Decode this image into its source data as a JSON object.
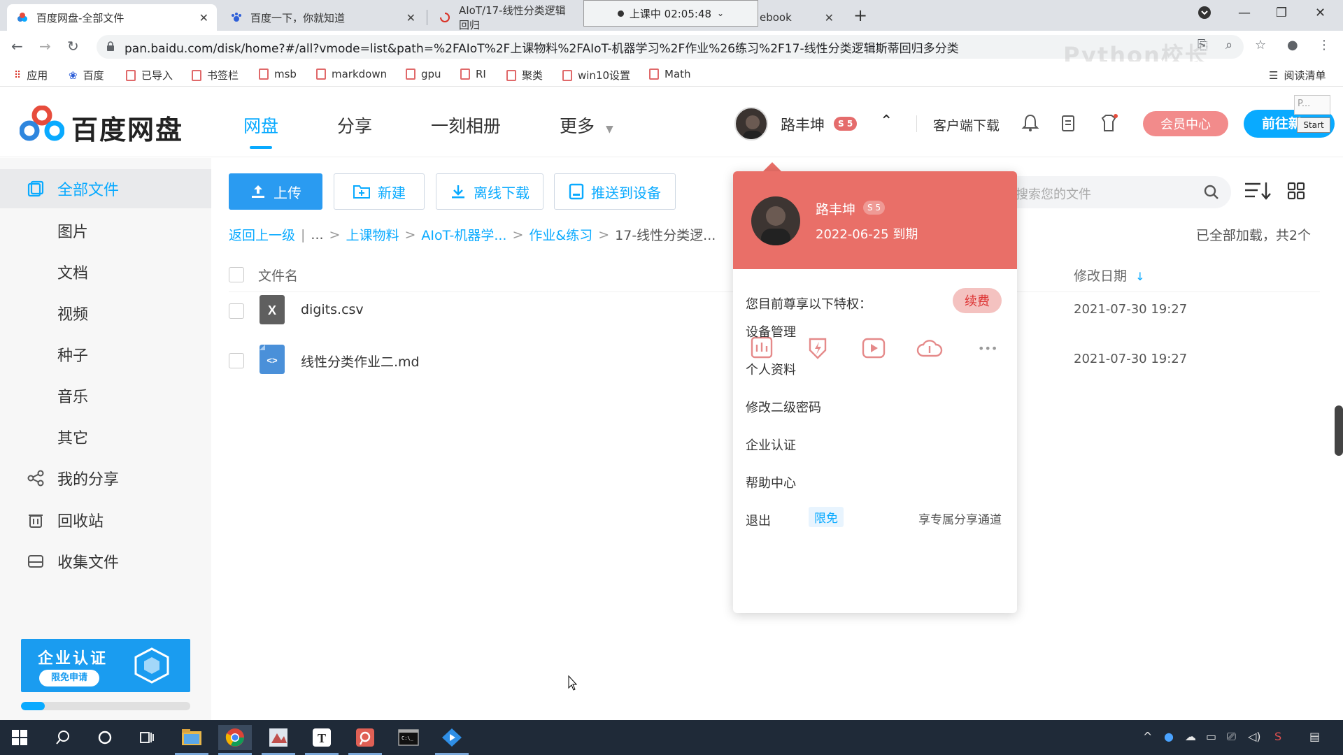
{
  "browser": {
    "tabs": [
      {
        "title": "百度网盘-全部文件"
      },
      {
        "title": "百度一下，你就知道"
      },
      {
        "title": "AIoT/17-线性分类逻辑回归"
      },
      {
        "title": "ebook"
      }
    ],
    "recording": "上课中 02:05:48",
    "url": "pan.baidu.com/disk/home?#/all?vmode=list&path=%2FAIoT%2F上课物料%2FAIoT-机器学习%2F作业%26练习%2F17-线性分类逻辑斯蒂回归多分类",
    "bookmarks": [
      "应用",
      "百度",
      "已导入",
      "书签栏",
      "msb",
      "markdown",
      "gpu",
      "RI",
      "聚类",
      "win10设置",
      "Math"
    ],
    "reading_list": "阅读清单",
    "watermark": "Python校长"
  },
  "header": {
    "logo_text": "百度网盘",
    "nav": [
      "网盘",
      "分享",
      "一刻相册",
      "更多"
    ],
    "username": "路丰坤",
    "svip_level": "5",
    "client_download": "客户端下载",
    "vip_center": "会员中心",
    "go_button": "前往新",
    "start_label": "Start",
    "p_label": "P..."
  },
  "sidebar": {
    "items": [
      {
        "label": "全部文件"
      },
      {
        "label": "图片"
      },
      {
        "label": "文档"
      },
      {
        "label": "视频"
      },
      {
        "label": "种子"
      },
      {
        "label": "音乐"
      },
      {
        "label": "其它"
      },
      {
        "label": "我的分享"
      },
      {
        "label": "回收站"
      },
      {
        "label": "收集文件"
      }
    ],
    "banner_title": "企业认证",
    "banner_button": "限免申请",
    "progress": 0.14
  },
  "toolbar": {
    "upload": "上传",
    "new": "新建",
    "offline": "离线下载",
    "push": "推送到设备",
    "search_placeholder": "搜索您的文件"
  },
  "breadcrumb": {
    "back": "返回上一级",
    "ellipsis": "...",
    "items": [
      "上课物料",
      "AIoT-机器学...",
      "作业&练习"
    ],
    "current": "17-线性分类逻...",
    "status": "已全部加载，共2个"
  },
  "file_list": {
    "columns": {
      "name": "文件名",
      "date": "修改日期"
    },
    "rows": [
      {
        "name": "digits.csv",
        "date": "2021-07-30 19:27"
      },
      {
        "name": "线性分类作业二.md",
        "date": "2021-07-30 19:27"
      }
    ]
  },
  "user_popup": {
    "name": "路丰坤",
    "level": "5",
    "expiry": "2022-06-25 到期",
    "privileges": "您目前尊享以下特权：",
    "renew": "续费",
    "more": "•••",
    "menu": [
      "设备管理",
      "个人资料",
      "修改二级密码",
      "企业认证",
      "帮助中心",
      "退出"
    ],
    "limit_tag": "限免",
    "enterprise_note": "享专属分享通道"
  },
  "colors": {
    "accent": "#09aaff",
    "popup_head": "#e96f68",
    "vip": "#f28b8b"
  }
}
